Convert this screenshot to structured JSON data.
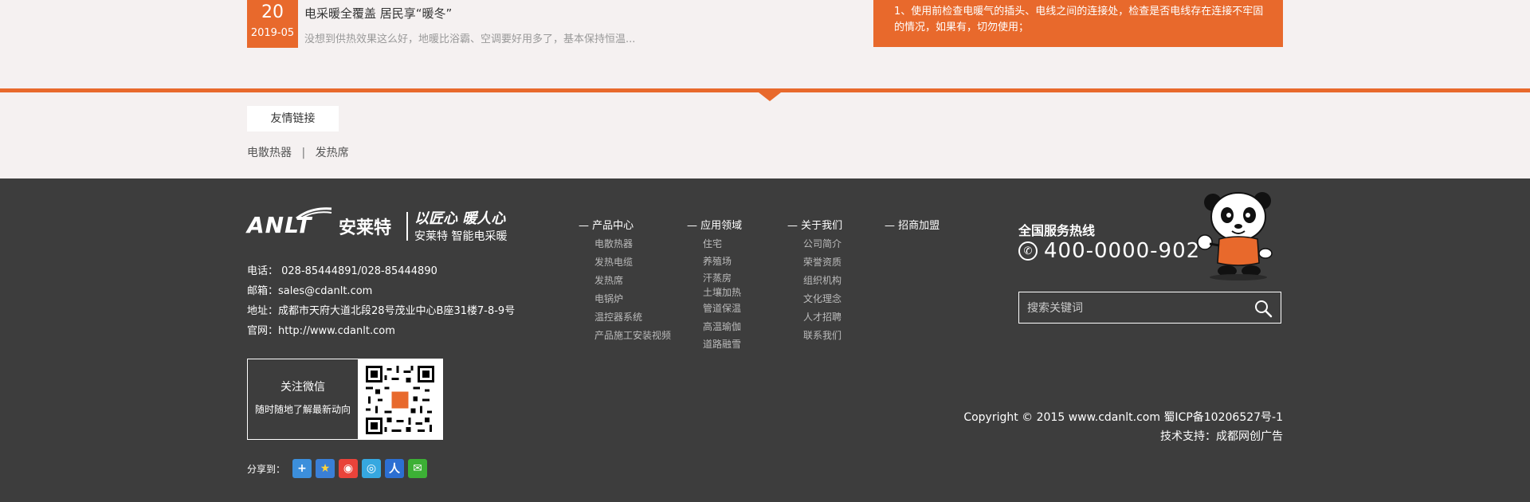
{
  "news": {
    "day": "20",
    "year_month": "2019-05",
    "title": "电采暖全覆盖 居民享“暖冬”",
    "desc": "没想到供热效果这么好，地暖比浴霸、空调要好用多了，基本保持恒温..."
  },
  "tip": {
    "text": "1、使用前检查电暖气的插头、电线之间的连接处，检查是否电线存在连接不牢固的情况，如果有，切勿使用；"
  },
  "friend_links": {
    "tab": "友情链接",
    "links": [
      "电散热器",
      "发热席"
    ],
    "separator": "|"
  },
  "footer": {
    "logo": {
      "brand": "ANLT",
      "cn_name": "安莱特",
      "slogan": "以匠心 暖人心",
      "sub": "安莱特  智能电采暖"
    },
    "contact": {
      "phone": "电话： 028-85444891/028-85444890",
      "email": "邮箱：sales@cdanlt.com",
      "address": "地址：成都市天府大道北段28号茂业中心B座31楼7-8-9号",
      "website": "官网：http://www.cdanlt.com"
    },
    "wechat": {
      "title": "关注微信",
      "sub": "随时随地了解最新动向"
    },
    "share": {
      "label": "分享到："
    },
    "nav": [
      {
        "head": "— 产品中心",
        "items": [
          "电散热器",
          "发热电缆",
          "发热席",
          "电锅炉",
          "温控器系统",
          "产品施工安装视频"
        ]
      },
      {
        "head": "— 应用领域",
        "items": [
          "住宅",
          "养殖场",
          "汗蒸房",
          "土壤加热",
          "管道保温",
          "高温瑜伽",
          "道路融雪"
        ]
      },
      {
        "head": "— 关于我们",
        "items": [
          "公司简介",
          "荣誉资质",
          "组织机构",
          "文化理念",
          "人才招聘",
          "联系我们"
        ]
      },
      {
        "head": "— 招商加盟",
        "items": []
      }
    ],
    "hotline": {
      "label": "全国服务热线",
      "number": "400-0000-902"
    },
    "search": {
      "placeholder": "搜索关键词"
    },
    "copyright": {
      "line1": "Copyright © 2015 www.cdanlt.com 蜀ICP备10206527号-1",
      "line2": "技术支持：成都网创广告"
    }
  },
  "colors": {
    "accent": "#e8692c",
    "footer_bg": "#3d3d3d",
    "page_bg": "#f5f1f1"
  }
}
